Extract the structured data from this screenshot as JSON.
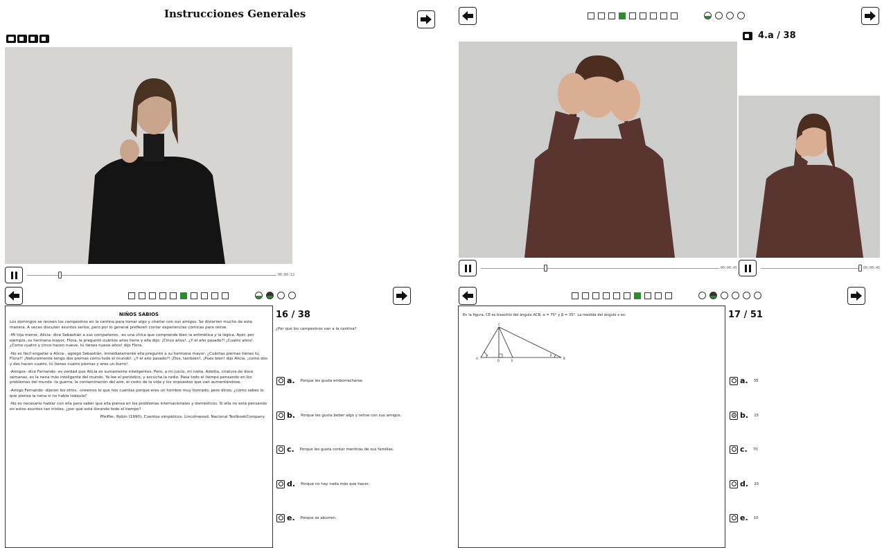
{
  "header": {
    "title": "Instrucciones Generales"
  },
  "q4": {
    "counter": "4.a / 38",
    "progress": {
      "squares": 9,
      "active": 4,
      "circles": [
        {
          "state": "half"
        },
        {
          "state": "empty"
        },
        {
          "state": "empty"
        },
        {
          "state": "empty"
        }
      ]
    }
  },
  "video_left": {
    "time": "00:00:12",
    "progress": 0.13
  },
  "video_right_main": {
    "time": "00:00:45",
    "progress": 0.27
  },
  "video_right_small": {
    "time": "00:00:45",
    "progress": 0.98
  },
  "q16": {
    "counter": "16 / 38",
    "question": "¿Por qué los campesinos van a la cantina?",
    "progress": {
      "squares": 10,
      "active": 6,
      "circles": [
        {
          "state": "half"
        },
        {
          "state": "filled-half"
        },
        {
          "state": "empty"
        },
        {
          "state": "empty"
        }
      ]
    },
    "story": {
      "title": "NIÑOS SABIOS",
      "paragraphs": [
        "Los domingos se reúnen los campesinos en la cantina para tomar algo y charlar con sus amigos. Se divierten mucho de esta manera. A veces discuten asuntos serios, pero por lo general prefieren contar experiencias cómicas para reírse.",
        "-Mi hija menor, Alicia- dice Sebastián a sus compañeros, -es una chica que comprende bien la aritmética y la lógica. Ayer, por ejemplo, su hermana mayor, Flora, le preguntó cuántos años tiene y ella dijo: ¡Cinco años!. ¿Y el año pasado?! ¡Cuatro años!. ¿Como cuatro y cinco hacen nueve, tú tienes nueve años! dijo Flora.",
        "-No es fácil engañar a Alicia-, agregó Sebastián. Inmediatamente ella preguntó a su hermana mayor: ¿Cuántas piernas tienes tú, Flora?! ¡Naturalmente tengo dos piernas como todo el mundo!. ¿Y el año pasado?! ¡Dos, también!. ¡Pues bien! dijo Alicia, ¡como dos y dos hacen cuatro, tú tienes cuatro piernas y eres un burro!.",
        "-Amigos- dice Fernando- es verdad que Alicia es sumamente inteligentes. Pero, a mi juicio, mi nieta, Adelita, criatura de doce semanas, es la nena más inteligente del mundo. Ya lee el periódico, y escucha la radio. Pasa todo el tiempo pensando en los problemas del mundo -la guerra, la contaminación del aire, el costo de la vida y los impuestos que van aumentándose.",
        "-Amigo Fernando- dijeron los otros, -creemos lo que nos cuentas porque eres un hombre muy honrado, pero dinos, ¿cómo sabes lo que piensa la nena si no habla todavía?",
        "-No es necesario hablar con ella para saber que ella piensa en los problemas internacionales y domésticos. Si ella no está pensando en estos asuntos tan tristes, ¿por qué está llorando todo el tiempo?"
      ],
      "citation": "Pfeiffer, Robin (1990). Cuentos simpáticos. Lincolnwood: Nacional TextbookCompany."
    },
    "options": [
      {
        "letter": "a.",
        "text": "Porque les gusta emborracharse.",
        "selected": false
      },
      {
        "letter": "b.",
        "text": "Porque les gusta beber algo y reírse con sus amigos.",
        "selected": false
      },
      {
        "letter": "c.",
        "text": "Porque les gusta contar mentiras de sus familias.",
        "selected": false
      },
      {
        "letter": "d.",
        "text": "Porque no hay nada más que hacer.",
        "selected": false
      },
      {
        "letter": "e.",
        "text": "Porque se aburren.",
        "selected": false
      }
    ]
  },
  "q17": {
    "counter": "17 / 51",
    "problem": "En la figura, CE es bisectriz del ángulo ACB, α = 75° y β = 35°. La medida del ángulo x es:",
    "figure_labels": {
      "c": "C",
      "a": "A",
      "d": "D",
      "e": "E",
      "b": "B",
      "alpha": "α",
      "beta": "β"
    },
    "progress": {
      "squares": 10,
      "active": 7,
      "circles": [
        {
          "state": "empty"
        },
        {
          "state": "filled-half"
        },
        {
          "state": "empty"
        },
        {
          "state": "empty"
        },
        {
          "state": "empty"
        },
        {
          "state": "empty"
        }
      ]
    },
    "options": [
      {
        "letter": "a.",
        "text": "35",
        "selected": false
      },
      {
        "letter": "b.",
        "text": "15",
        "selected": true
      },
      {
        "letter": "c.",
        "text": "70",
        "selected": false
      },
      {
        "letter": "d.",
        "text": "20",
        "selected": false
      },
      {
        "letter": "e.",
        "text": "10",
        "selected": false
      }
    ]
  }
}
